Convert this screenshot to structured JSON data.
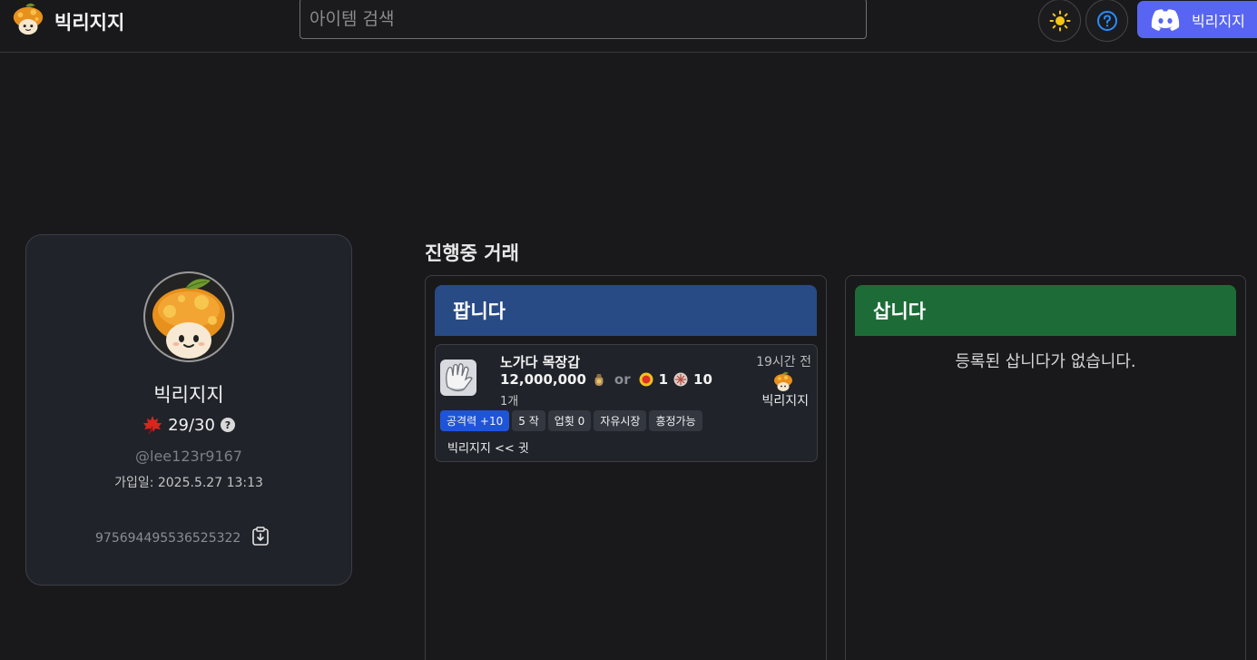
{
  "header": {
    "brand": "빅리지지",
    "search_placeholder": "아이템 검색",
    "theme_icon": "sun-icon",
    "help_icon": "question-circle-icon",
    "discord_label": "빅리지지"
  },
  "profile": {
    "name": "빅리지지",
    "rating": "29/30",
    "rating_help": "?",
    "handle": "@lee123r9167",
    "joined": "가입일: 2025.5.27 13:13",
    "user_id": "975694495536525322"
  },
  "trades": {
    "title": "진행중 거래",
    "sell": {
      "heading": "팝니다",
      "items": [
        {
          "name": "노가다 목장갑",
          "price": "12,000,000",
          "or": "or",
          "alt1": "1",
          "alt2": "10",
          "quantity": "1개",
          "time": "19시간 전",
          "seller": "빅리지지",
          "tags": [
            "공격력 +10",
            "5 작",
            "업횟 0",
            "자유시장",
            "흥정가능"
          ],
          "memo": "빅리지지 << 귓"
        }
      ]
    },
    "buy": {
      "heading": "삽니다",
      "empty": "등록된 삽니다가 없습니다."
    }
  },
  "colors": {
    "background": "#19191b",
    "card": "#20232a",
    "sell_header": "#284a85",
    "buy_header": "#1d6c37",
    "discord": "#5865f2",
    "tag_blue": "#1e55d8"
  }
}
